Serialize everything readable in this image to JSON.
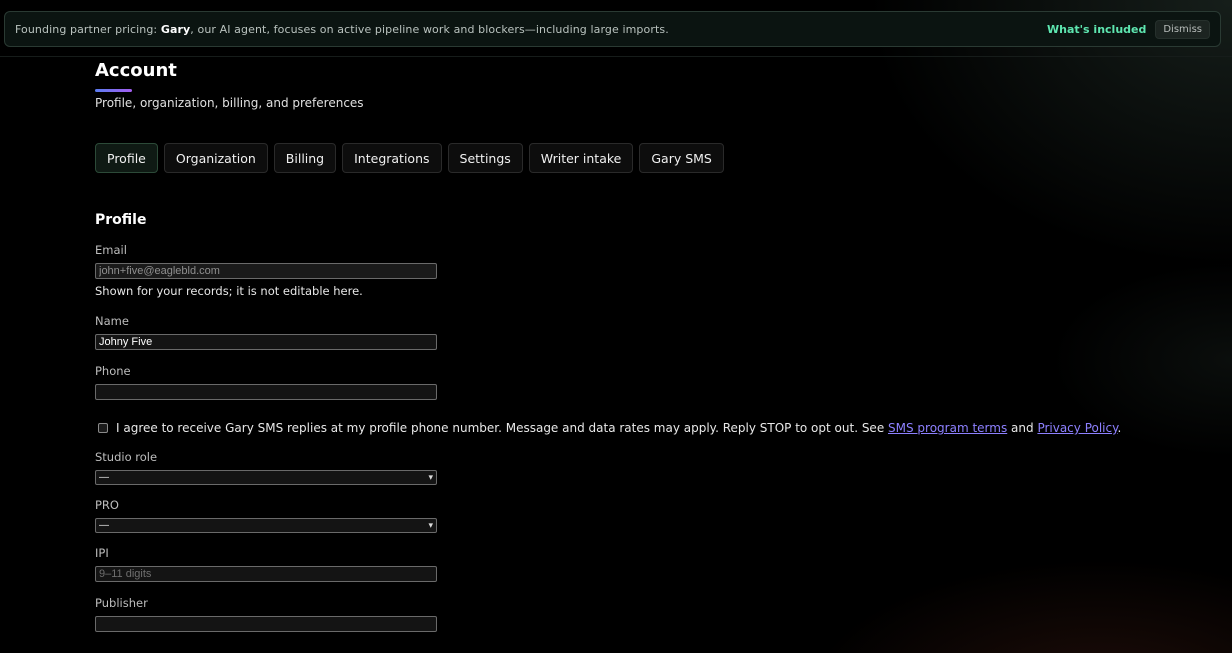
{
  "banner": {
    "prefix": "Founding partner pricing: ",
    "agent_name": "Gary",
    "suffix": ", our AI agent, focuses on active pipeline work and blockers—including large imports.",
    "whats_included": "What's included",
    "dismiss": "Dismiss"
  },
  "header": {
    "title": "Account",
    "subtitle": "Profile, organization, billing, and preferences"
  },
  "tabs": [
    {
      "label": "Profile",
      "active": true
    },
    {
      "label": "Organization"
    },
    {
      "label": "Billing"
    },
    {
      "label": "Integrations"
    },
    {
      "label": "Settings"
    },
    {
      "label": "Writer intake"
    },
    {
      "label": "Gary SMS"
    }
  ],
  "profile": {
    "section_title": "Profile",
    "email": {
      "label": "Email",
      "value": "john+five@eaglebld.com",
      "helper": "Shown for your records; it is not editable here."
    },
    "name": {
      "label": "Name",
      "value": "Johny Five"
    },
    "phone": {
      "label": "Phone",
      "value": ""
    },
    "consent": {
      "text": "I agree to receive Gary SMS replies at my profile phone number. Message and data rates may apply. Reply STOP to opt out. See ",
      "terms_link": "SMS program terms",
      "and": " and ",
      "privacy_link": "Privacy Policy",
      "end": ".",
      "checked": false
    },
    "studio_role": {
      "label": "Studio role",
      "value": "—"
    },
    "pro": {
      "label": "PRO",
      "value": "—"
    },
    "ipi": {
      "label": "IPI",
      "placeholder": "9–11 digits",
      "value": ""
    },
    "publisher": {
      "label": "Publisher",
      "value": ""
    }
  },
  "colors": {
    "accent_green": "#5ee6b0",
    "link_purple": "#8d80ff",
    "active_tab_border": "#2c4a38"
  }
}
